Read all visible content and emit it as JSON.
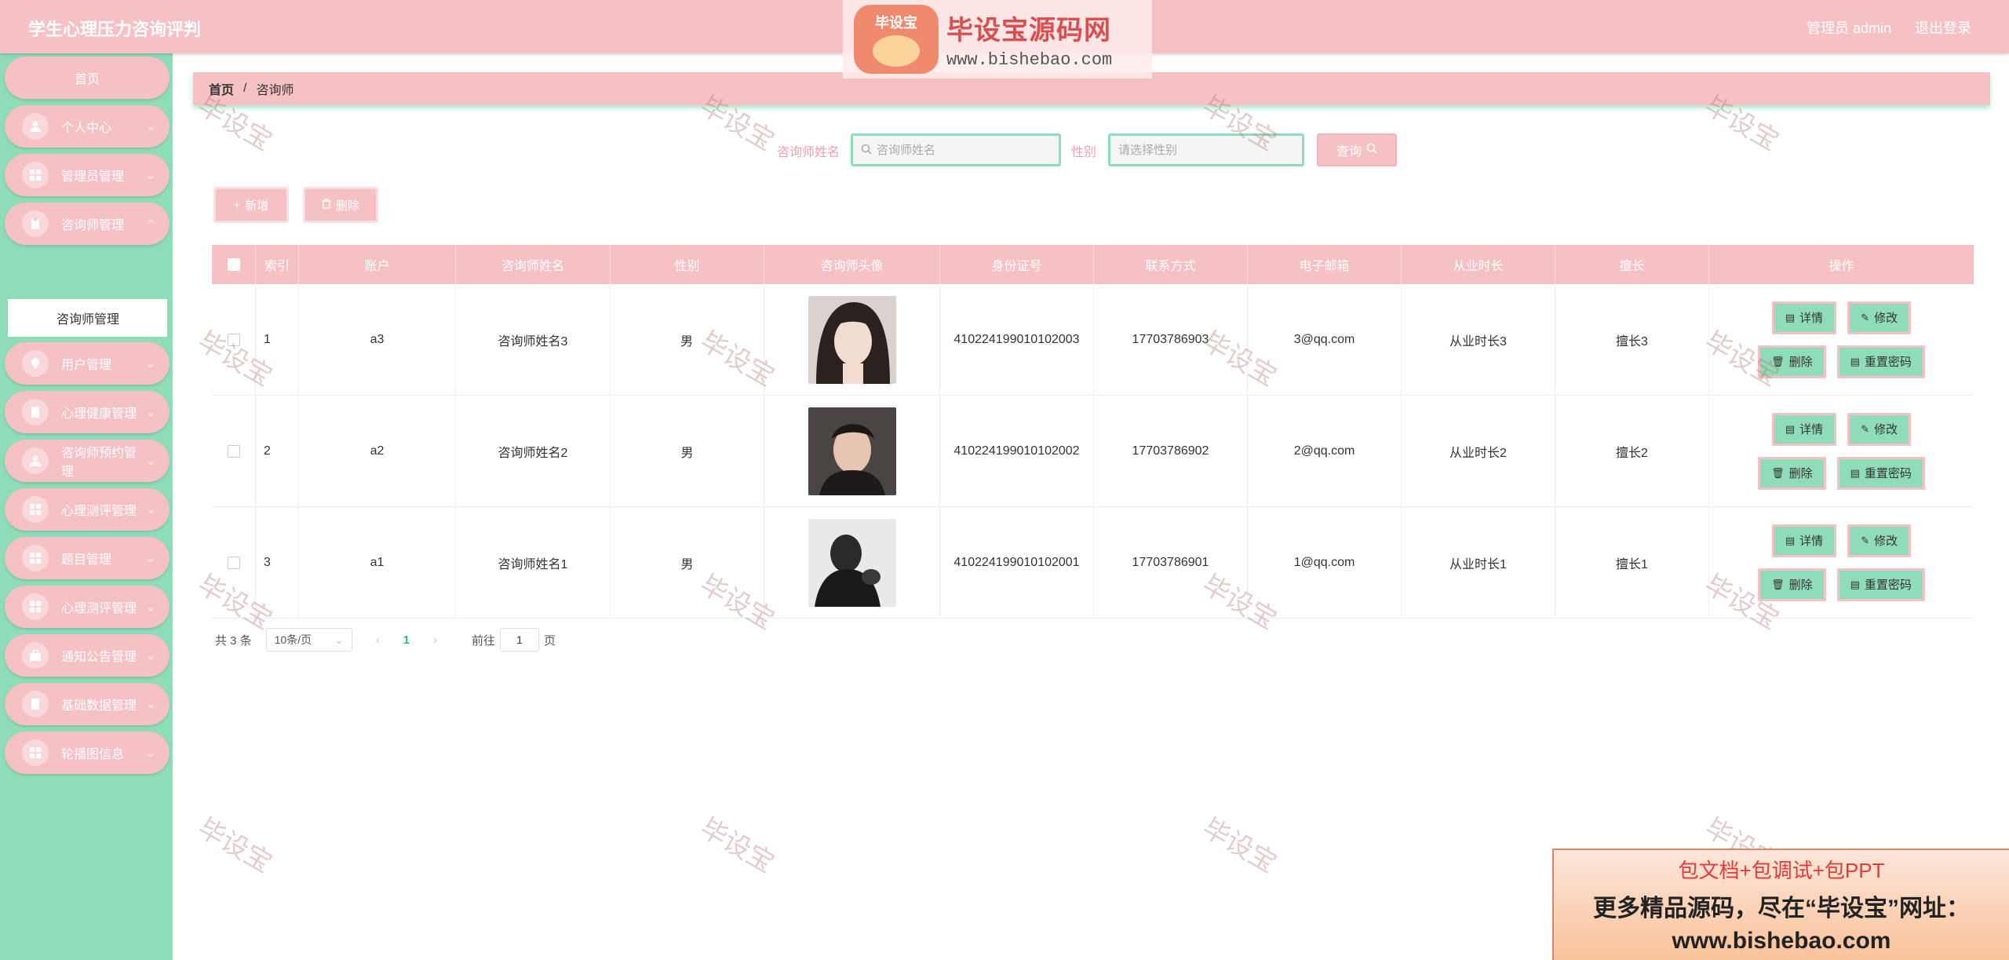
{
  "app": {
    "title": "学生心理压力咨询评判",
    "admin": "管理员 admin",
    "logout": "退出登录"
  },
  "sidebar": {
    "home": "首页",
    "items": [
      {
        "label": "个人中心",
        "icon": "user-icon"
      },
      {
        "label": "管理员管理",
        "icon": "grid-icon"
      },
      {
        "label": "咨询师管理",
        "icon": "clipboard-icon"
      },
      {
        "label": "用户管理",
        "icon": "location-icon"
      },
      {
        "label": "心理健康管理",
        "icon": "doc-icon"
      },
      {
        "label": "咨询师预约管理",
        "icon": "user-icon"
      },
      {
        "label": "心理测评管理",
        "icon": "grid-icon"
      },
      {
        "label": "题目管理",
        "icon": "grid-icon"
      },
      {
        "label": "心理测评管理",
        "icon": "grid-icon"
      },
      {
        "label": "通知公告管理",
        "icon": "bag-icon"
      },
      {
        "label": "基础数据管理",
        "icon": "doc-icon"
      },
      {
        "label": "轮播图信息",
        "icon": "grid-icon"
      }
    ],
    "active_sub": "咨询师管理"
  },
  "breadcrumb": {
    "home": "首页",
    "separator": "/",
    "current": "咨询师"
  },
  "search": {
    "name_label": "咨询师姓名",
    "name_placeholder": "咨询师姓名",
    "gender_label": "性别",
    "gender_placeholder": "请选择性别",
    "query_label": "查询"
  },
  "actions": {
    "add": "新增",
    "delete": "删除"
  },
  "table": {
    "headers": [
      "",
      "索引",
      "账户",
      "咨询师姓名",
      "性别",
      "咨询师头像",
      "身份证号",
      "联系方式",
      "电子邮箱",
      "从业时长",
      "擅长",
      "操作"
    ],
    "rows": [
      {
        "index": "1",
        "account": "a3",
        "name": "咨询师姓名3",
        "gender": "男",
        "idcard": "410224199010102003",
        "phone": "17703786903",
        "email": "3@qq.com",
        "years": "从业时长3",
        "specialty": "擅长3"
      },
      {
        "index": "2",
        "account": "a2",
        "name": "咨询师姓名2",
        "gender": "男",
        "idcard": "410224199010102002",
        "phone": "17703786902",
        "email": "2@qq.com",
        "years": "从业时长2",
        "specialty": "擅长2"
      },
      {
        "index": "3",
        "account": "a1",
        "name": "咨询师姓名1",
        "gender": "男",
        "idcard": "410224199010102001",
        "phone": "17703786901",
        "email": "1@qq.com",
        "years": "从业时长1",
        "specialty": "擅长1"
      }
    ],
    "op_labels": {
      "detail": "详情",
      "edit": "修改",
      "delete": "删除",
      "reset": "重置密码"
    }
  },
  "pager": {
    "total": "共 3 条",
    "size": "10条/页",
    "prev": "‹",
    "current": "1",
    "next": "›",
    "goto_prefix": "前往",
    "goto_value": "1",
    "goto_suffix": "页"
  },
  "watermark": {
    "text": "毕设宝",
    "logo_badge": "毕设宝",
    "logo_title": "毕设宝源码网",
    "logo_url": "www.bishebao.com"
  },
  "ad": {
    "line1": "包文档+包调试+包PPT",
    "line2": "更多精品源码，尽在“毕设宝”网址：",
    "line3": "www.bishebao.com"
  },
  "colors": {
    "pink": "#f6c1c5",
    "mint": "#8fdcb8",
    "page_active": "#3cb371"
  }
}
